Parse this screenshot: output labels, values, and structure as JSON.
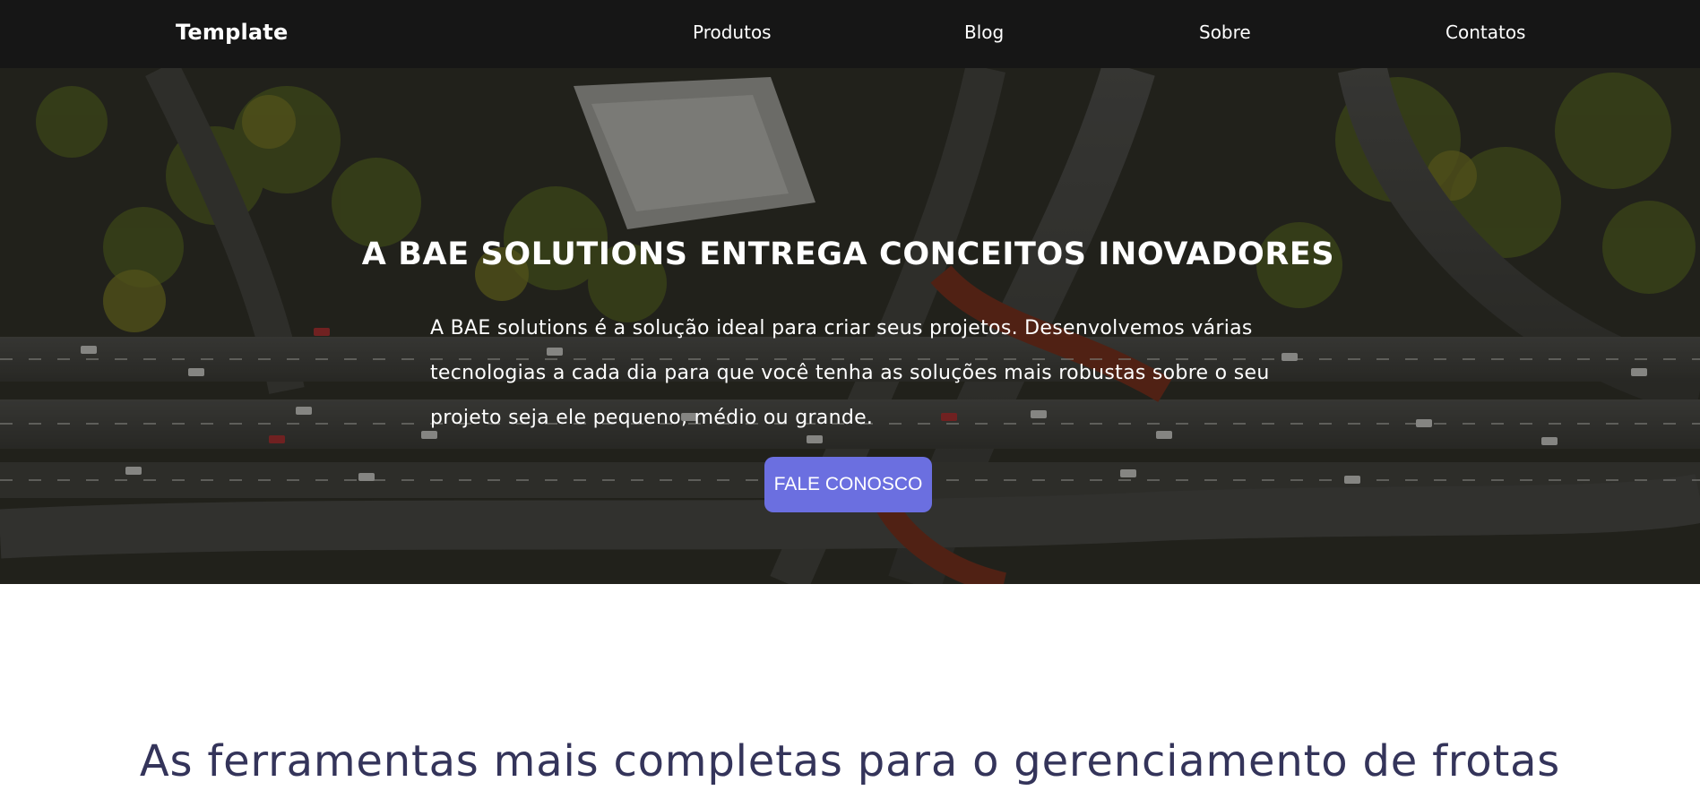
{
  "navbar": {
    "brand": "Template",
    "links": [
      "Produtos",
      "Blog",
      "Sobre",
      "Contatos"
    ]
  },
  "hero": {
    "title": "A BAE SOLUTIONS ENTREGA CONCEITOS INOVADORES",
    "text": "A BAE solutions é a solução ideal para criar seus projetos. Desenvolvemos várias tecnologias a cada dia para que você tenha as soluções mais robustas sobre o seu projeto seja ele pequeno, médio ou grande.",
    "cta_label": "FALE CONOSCO",
    "background_image": "aerial-highway-interchange-photo"
  },
  "features": {
    "title": "As ferramentas mais completas para o gerenciamento de frotas"
  },
  "colors": {
    "navbar_bg": "#161616",
    "cta_bg": "#6b6fe0",
    "section_title": "#34345a"
  }
}
